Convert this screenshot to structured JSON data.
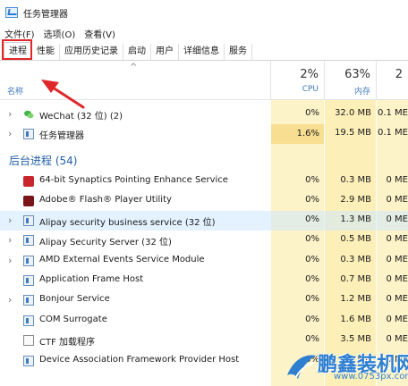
{
  "window": {
    "title": "任务管理器"
  },
  "menu": [
    "文件(F)",
    "选项(O)",
    "查看(V)"
  ],
  "tabs": [
    "进程",
    "性能",
    "应用历史记录",
    "启动",
    "用户",
    "详细信息",
    "服务"
  ],
  "active_tab": "进程",
  "header": {
    "name_label": "名称",
    "cpu": {
      "percent": "2%",
      "label": "CPU"
    },
    "memory": {
      "percent": "63%",
      "label": "内存"
    },
    "disk": {
      "percent": "2",
      "label": ""
    }
  },
  "apps": [
    {
      "name": "WeChat (32 位) (2)",
      "cpu": "0%",
      "mem": "32.0 MB",
      "disk": "0.1 ME",
      "icon": "wechat-icon"
    },
    {
      "name": "任务管理器",
      "cpu": "1.6%",
      "mem": "19.5 MB",
      "disk": "0.1 ME",
      "icon": "task-manager-icon"
    }
  ],
  "background_group": {
    "label": "后台进程 (54)"
  },
  "background": [
    {
      "name": "64-bit Synaptics Pointing Enhance Service",
      "cpu": "0%",
      "mem": "0.3 MB",
      "disk": "0 ME",
      "icon": "synaptics-icon"
    },
    {
      "name": "Adobe® Flash® Player Utility",
      "cpu": "0%",
      "mem": "2.9 MB",
      "disk": "0 ME",
      "icon": "flash-icon"
    },
    {
      "name": "Alipay security business service (32 位)",
      "cpu": "0%",
      "mem": "1.3 MB",
      "disk": "0 ME",
      "icon": "service-icon"
    },
    {
      "name": "Alipay Security Server (32 位)",
      "cpu": "0%",
      "mem": "0.5 MB",
      "disk": "0 ME",
      "icon": "service-icon"
    },
    {
      "name": "AMD External Events Service Module",
      "cpu": "0%",
      "mem": "0.3 MB",
      "disk": "0 ME",
      "icon": "service-icon"
    },
    {
      "name": "Application Frame Host",
      "cpu": "0%",
      "mem": "0.7 MB",
      "disk": "0 ME",
      "icon": "service-icon"
    },
    {
      "name": "Bonjour Service",
      "cpu": "0%",
      "mem": "1.2 MB",
      "disk": "0 ME",
      "icon": "service-icon"
    },
    {
      "name": "COM Surrogate",
      "cpu": "0%",
      "mem": "1.6 MB",
      "disk": "0 ME",
      "icon": "service-icon"
    },
    {
      "name": "CTF 加载程序",
      "cpu": "0%",
      "mem": "3.5 MB",
      "disk": "0 ME",
      "icon": "ctf-icon"
    },
    {
      "name": "Device Association Framework Provider Host",
      "cpu": "0%",
      "mem": "0.3 MB",
      "disk": "0 ME",
      "icon": "service-icon"
    }
  ],
  "watermark": {
    "text": "鹏鑫装机网",
    "url": "www.0753px.com"
  }
}
